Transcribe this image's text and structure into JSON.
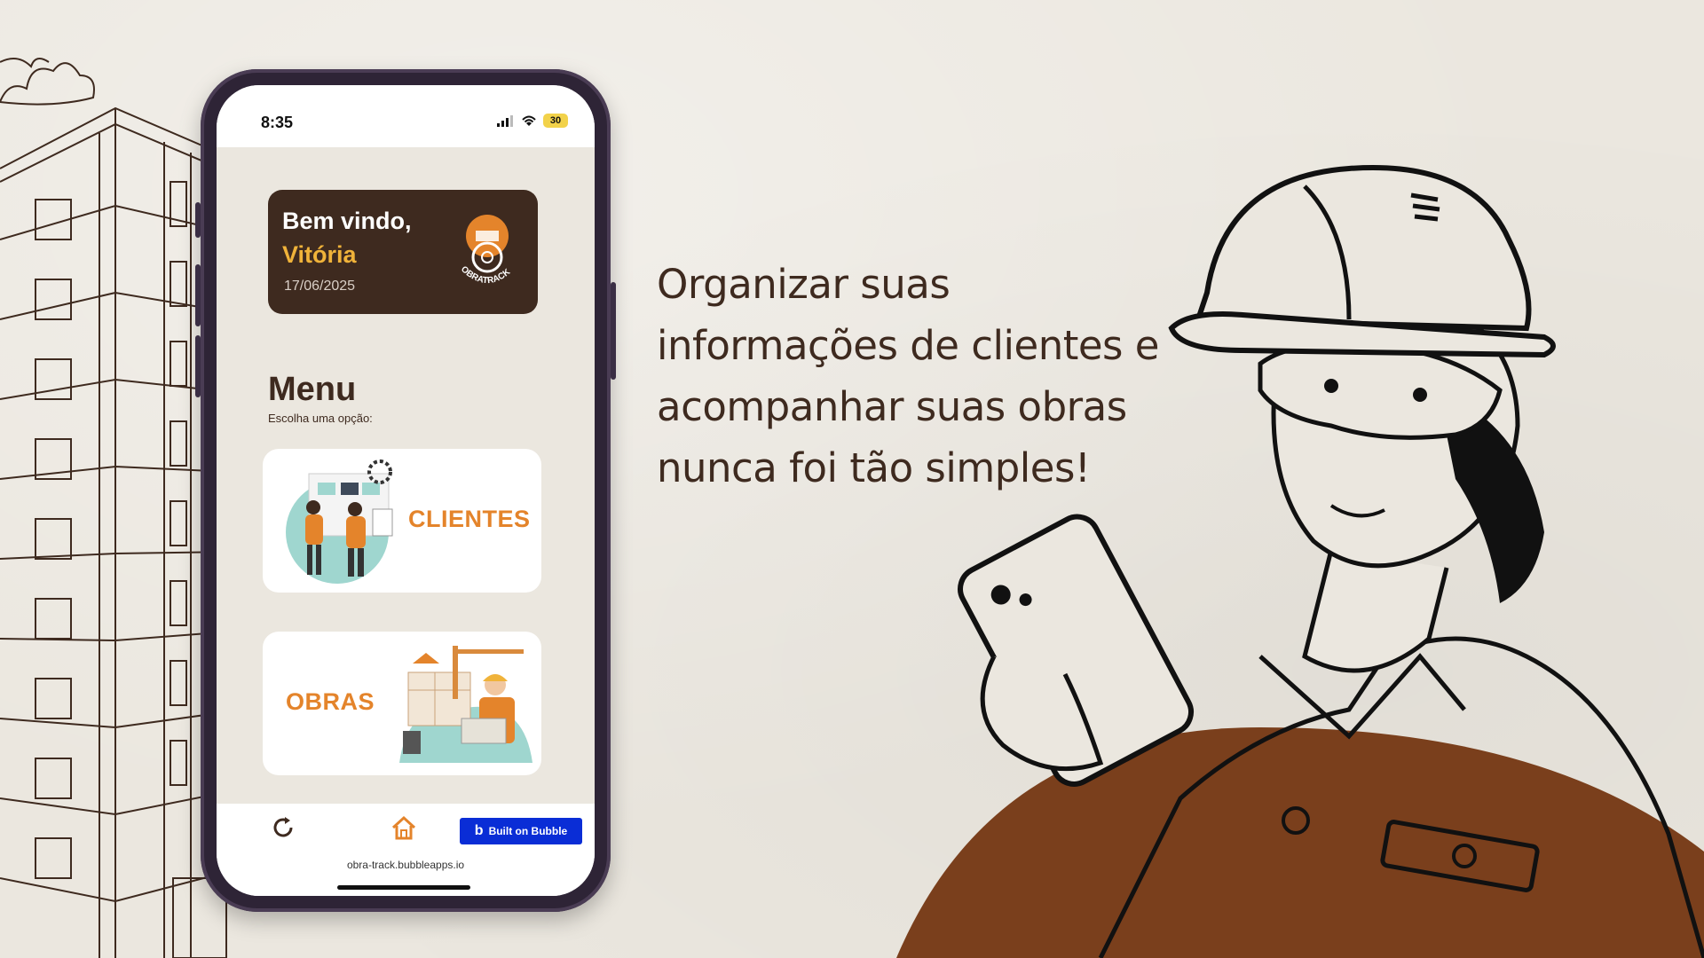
{
  "phone": {
    "status_time": "8:35",
    "battery": "30",
    "welcome": {
      "greeting": "Bem vindo,",
      "name": "Vitória",
      "date": "17/06/2025",
      "logo_text": "OBRATRACK"
    },
    "menu": {
      "title": "Menu",
      "subtitle": "Escolha uma opção:",
      "items": [
        {
          "label": "CLIENTES"
        },
        {
          "label": "OBRAS"
        }
      ]
    },
    "bottom_nav": {
      "icons": [
        "refresh-icon",
        "home-icon"
      ],
      "bubble_badge": "Built on Bubble"
    },
    "url": "obra-track.bubbleapps.io"
  },
  "tagline": "Organizar suas informações de clientes e acompanhar suas obras nunca foi tão simples!",
  "colors": {
    "background": "#ebe7df",
    "dark_brown": "#3e2a1f",
    "accent_orange": "#e4842b",
    "accent_gold": "#f0b33a",
    "worker_shirt": "#7a3f1c",
    "bubble_blue": "#0a2dd6"
  }
}
